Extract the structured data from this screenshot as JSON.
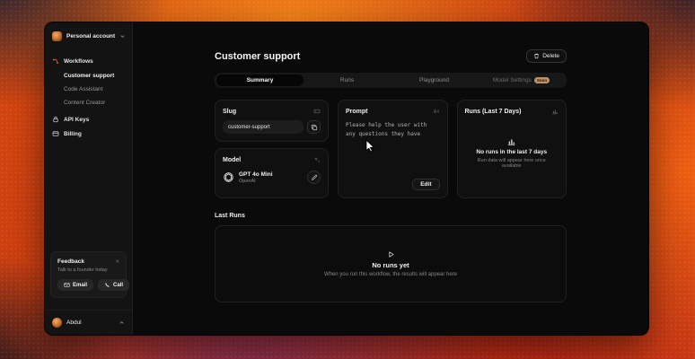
{
  "window": {
    "sidebar": {
      "account": {
        "label": "Personal account"
      },
      "nav": {
        "workflows": {
          "label": "Workflows"
        },
        "workflow_items": [
          {
            "label": "Customer support",
            "active": true
          },
          {
            "label": "Code Assistant",
            "active": false
          },
          {
            "label": "Content Creator",
            "active": false
          }
        ],
        "api_keys": {
          "label": "API Keys"
        },
        "billing": {
          "label": "Billing"
        }
      },
      "feedback": {
        "title": "Feedback",
        "subtitle": "Talk to a founder today",
        "email_label": "Email",
        "call_label": "Call"
      },
      "user": {
        "name": "Abdul"
      }
    },
    "main": {
      "header": {
        "title": "Customer support",
        "delete_label": "Delete"
      },
      "tabs": [
        {
          "label": "Summary",
          "active": true
        },
        {
          "label": "Runs",
          "active": false
        },
        {
          "label": "Playground",
          "active": false
        },
        {
          "label": "Model Settings",
          "active": false,
          "badge": "Soon"
        }
      ],
      "slug_card": {
        "title": "Slug",
        "value": "customer-support"
      },
      "model_card": {
        "title": "Model",
        "model_name": "GPT 4o Mini",
        "provider": "OpenAI"
      },
      "prompt_card": {
        "title": "Prompt",
        "text": "Please help the user with any questions they have",
        "edit_label": "Edit"
      },
      "runs_card": {
        "title": "Runs (Last 7 Days)",
        "empty_title": "No runs in the last 7 days",
        "empty_subtitle": "Run data will appear here once available"
      },
      "last_runs": {
        "title": "Last Runs",
        "empty_title": "No runs yet",
        "empty_subtitle": "When you run this workflow, the results will appear here"
      }
    }
  },
  "colors": {
    "workflows_accent": "#e0532f",
    "badge_bg": "#bf9166",
    "window_bg": "#0a0a0a",
    "sidebar_bg": "#131313"
  }
}
